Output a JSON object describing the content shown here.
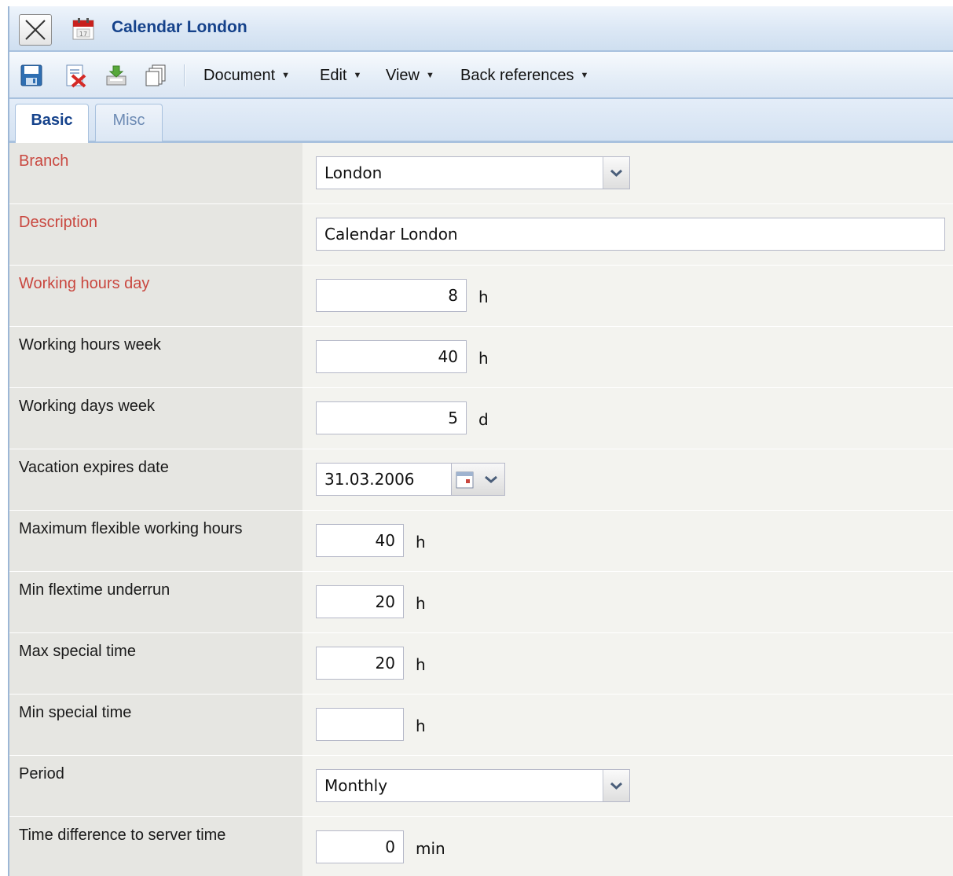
{
  "window": {
    "title": "Calendar London",
    "close_icon": "close-icon",
    "app_icon": "calendar-icon"
  },
  "toolbar": {
    "icons": [
      "save-icon",
      "delete-icon",
      "export-icon",
      "copy-icon"
    ],
    "menus": [
      {
        "label": "Document"
      },
      {
        "label": "Edit"
      },
      {
        "label": "View"
      },
      {
        "label": "Back references"
      }
    ]
  },
  "tabs": [
    {
      "label": "Basic",
      "active": true
    },
    {
      "label": "Misc",
      "active": false
    }
  ],
  "form": {
    "fields": [
      {
        "label": "Branch",
        "required": true,
        "type": "select",
        "value": "London"
      },
      {
        "label": "Description",
        "required": true,
        "type": "text",
        "value": "Calendar London"
      },
      {
        "label": "Working hours day",
        "required": true,
        "type": "number",
        "value": "8",
        "unit": "h"
      },
      {
        "label": "Working hours week",
        "required": false,
        "type": "number",
        "value": "40",
        "unit": "h"
      },
      {
        "label": "Working days week",
        "required": false,
        "type": "number",
        "value": "5",
        "unit": "d"
      },
      {
        "label": "Vacation expires date",
        "required": false,
        "type": "date",
        "value": "31.03.2006"
      },
      {
        "label": "Maximum flexible working hours",
        "required": false,
        "type": "number",
        "value": "40",
        "unit": "h"
      },
      {
        "label": "Min flextime underrun",
        "required": false,
        "type": "number",
        "value": "20",
        "unit": "h"
      },
      {
        "label": "Max special time",
        "required": false,
        "type": "number",
        "value": "20",
        "unit": "h"
      },
      {
        "label": "Min special time",
        "required": false,
        "type": "number",
        "value": "",
        "unit": "h"
      },
      {
        "label": "Period",
        "required": false,
        "type": "select",
        "value": "Monthly"
      },
      {
        "label": "Time difference to server time",
        "required": false,
        "type": "number",
        "value": "0",
        "unit": "min"
      }
    ]
  },
  "colors": {
    "title": "#15428b",
    "required_label": "#c9473f",
    "label_bg": "#e6e6e2",
    "field_bg": "#f3f3ef",
    "frame_border": "#a8c1de"
  }
}
